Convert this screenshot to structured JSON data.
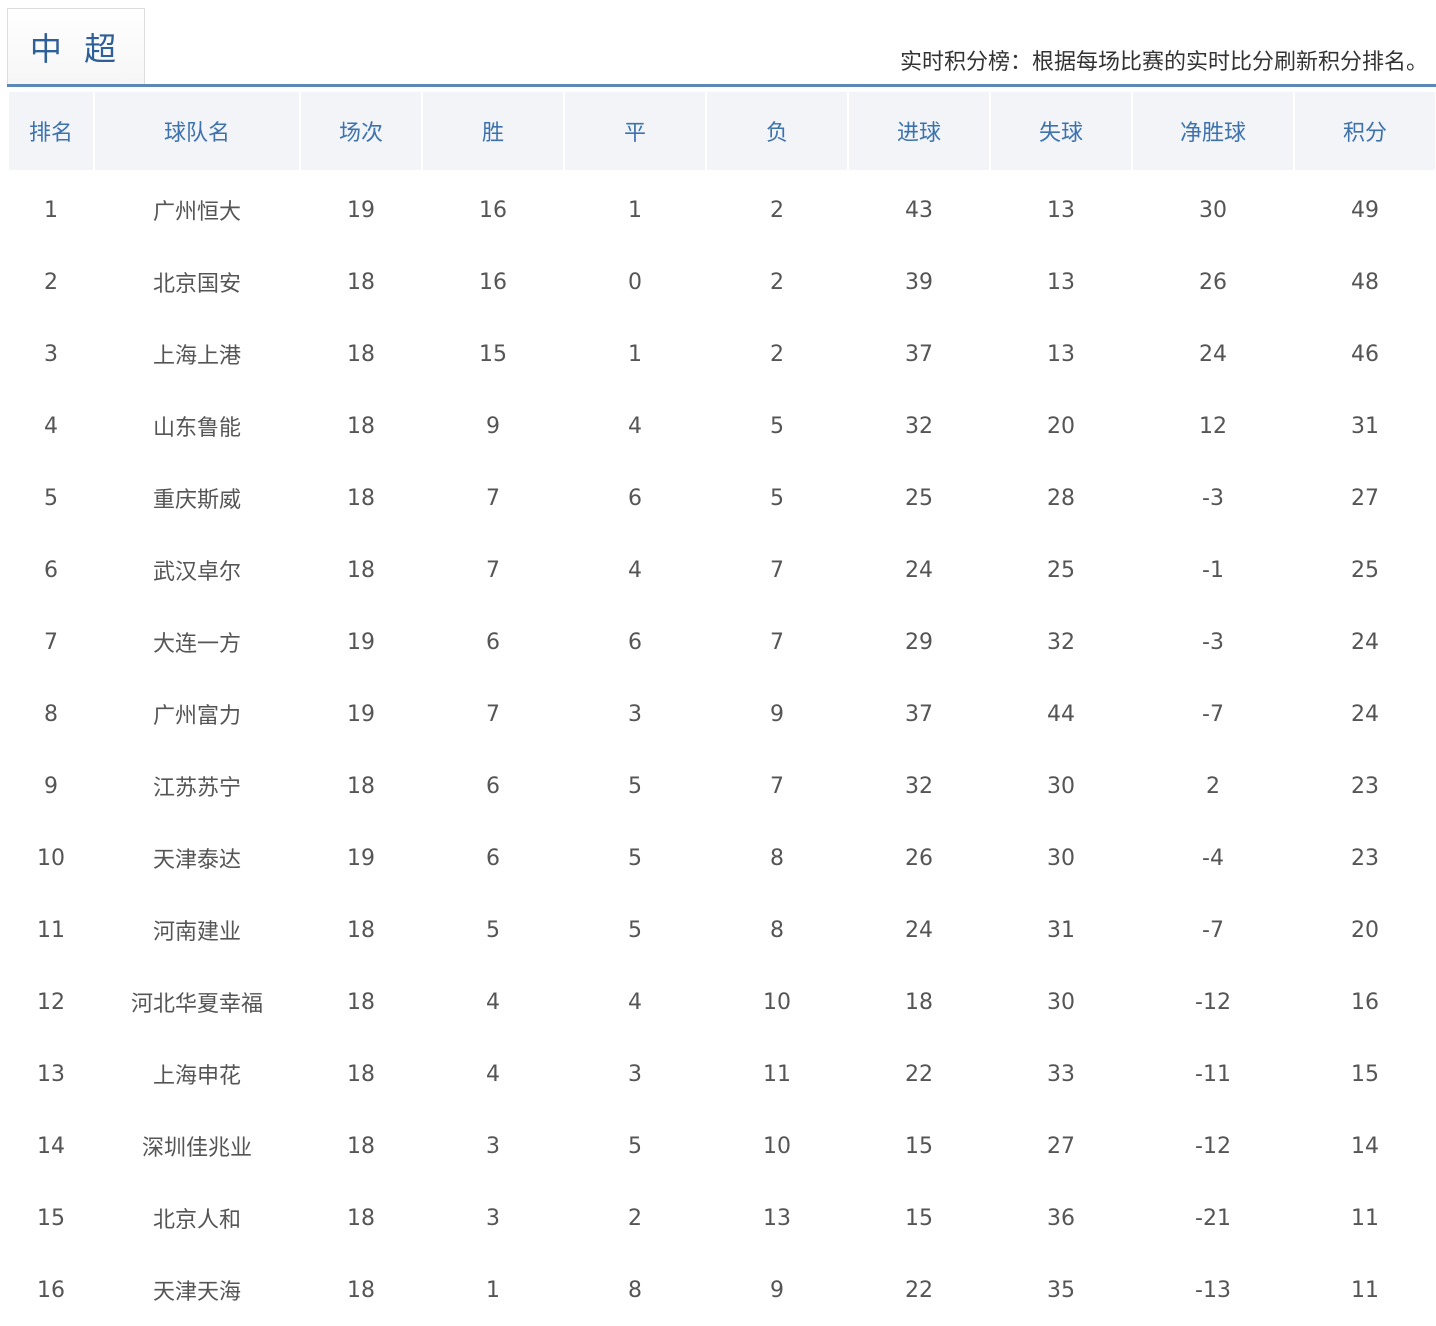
{
  "league": {
    "tab_label": "中 超",
    "note": "实时积分榜：根据每场比赛的实时比分刷新积分排名。"
  },
  "table": {
    "headers": [
      "排名",
      "球队名",
      "场次",
      "胜",
      "平",
      "负",
      "进球",
      "失球",
      "净胜球",
      "积分"
    ],
    "rows": [
      [
        "1",
        "广州恒大",
        "19",
        "16",
        "1",
        "2",
        "43",
        "13",
        "30",
        "49"
      ],
      [
        "2",
        "北京国安",
        "18",
        "16",
        "0",
        "2",
        "39",
        "13",
        "26",
        "48"
      ],
      [
        "3",
        "上海上港",
        "18",
        "15",
        "1",
        "2",
        "37",
        "13",
        "24",
        "46"
      ],
      [
        "4",
        "山东鲁能",
        "18",
        "9",
        "4",
        "5",
        "32",
        "20",
        "12",
        "31"
      ],
      [
        "5",
        "重庆斯威",
        "18",
        "7",
        "6",
        "5",
        "25",
        "28",
        "-3",
        "27"
      ],
      [
        "6",
        "武汉卓尔",
        "18",
        "7",
        "4",
        "7",
        "24",
        "25",
        "-1",
        "25"
      ],
      [
        "7",
        "大连一方",
        "19",
        "6",
        "6",
        "7",
        "29",
        "32",
        "-3",
        "24"
      ],
      [
        "8",
        "广州富力",
        "19",
        "7",
        "3",
        "9",
        "37",
        "44",
        "-7",
        "24"
      ],
      [
        "9",
        "江苏苏宁",
        "18",
        "6",
        "5",
        "7",
        "32",
        "30",
        "2",
        "23"
      ],
      [
        "10",
        "天津泰达",
        "19",
        "6",
        "5",
        "8",
        "26",
        "30",
        "-4",
        "23"
      ],
      [
        "11",
        "河南建业",
        "18",
        "5",
        "5",
        "8",
        "24",
        "31",
        "-7",
        "20"
      ],
      [
        "12",
        "河北华夏幸福",
        "18",
        "4",
        "4",
        "10",
        "18",
        "30",
        "-12",
        "16"
      ],
      [
        "13",
        "上海申花",
        "18",
        "4",
        "3",
        "11",
        "22",
        "33",
        "-11",
        "15"
      ],
      [
        "14",
        "深圳佳兆业",
        "18",
        "3",
        "5",
        "10",
        "15",
        "27",
        "-12",
        "14"
      ],
      [
        "15",
        "北京人和",
        "18",
        "3",
        "2",
        "13",
        "15",
        "36",
        "-21",
        "11"
      ],
      [
        "16",
        "天津天海",
        "18",
        "1",
        "8",
        "9",
        "22",
        "35",
        "-13",
        "11"
      ]
    ]
  },
  "colors": {
    "accent": "#3d72ad",
    "rule": "#5c88b8",
    "header_bg": "#f2f4f8",
    "text": "#555555"
  }
}
